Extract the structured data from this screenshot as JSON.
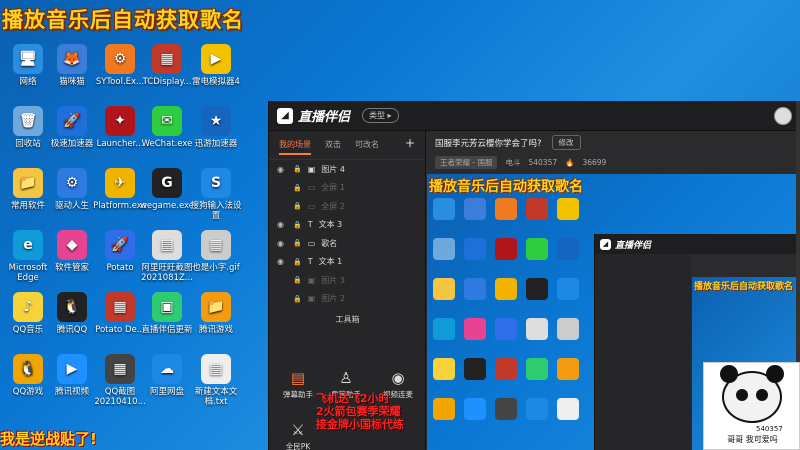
{
  "overlay_title": "播放音乐后自动获取歌名",
  "bottom_banner": "我是逆战贴了!",
  "desktop": {
    "icons": [
      {
        "label": "网络",
        "color": "#2a8ee0",
        "glyph": "🖥"
      },
      {
        "label": "猫咪猫",
        "color": "#3b7dd8",
        "glyph": "🦊"
      },
      {
        "label": "SYTool.Ex...",
        "color": "#f07a20",
        "glyph": "⚙"
      },
      {
        "label": "TCDisplay...",
        "color": "#c0392b",
        "glyph": "▦"
      },
      {
        "label": "雷电模拟器4",
        "color": "#f2c200",
        "glyph": "▶"
      },
      {
        "label": "回收站",
        "color": "#6fa8dc",
        "glyph": "🗑"
      },
      {
        "label": "极速加速器",
        "color": "#1e6fd9",
        "glyph": "🚀"
      },
      {
        "label": "Launcher...",
        "color": "#b0151c",
        "glyph": "✦"
      },
      {
        "label": "WeChat.exe",
        "color": "#2ecc40",
        "glyph": "✉"
      },
      {
        "label": "迅游加速器",
        "color": "#1565c0",
        "glyph": "★"
      },
      {
        "label": "常用软件",
        "color": "#f5c542",
        "glyph": "📁"
      },
      {
        "label": "驱动人生",
        "color": "#2d7be0",
        "glyph": "⚙"
      },
      {
        "label": "Platform.exe",
        "color": "#f0b400",
        "glyph": "✈"
      },
      {
        "label": "wegame.exe",
        "color": "#222222",
        "glyph": "G"
      },
      {
        "label": "搜狗输入法设置",
        "color": "#1e88e5",
        "glyph": "S"
      },
      {
        "label": "Microsoft Edge",
        "color": "#0f9bd7",
        "glyph": "e"
      },
      {
        "label": "软件管家",
        "color": "#e84393",
        "glyph": "◆"
      },
      {
        "label": "Potato",
        "color": "#2f6ee8",
        "glyph": "🚀"
      },
      {
        "label": "阿里旺旺截图 2021081Z...",
        "color": "#dddddd",
        "glyph": "▤"
      },
      {
        "label": "也是小字.gif",
        "color": "#cccccc",
        "glyph": "▦"
      },
      {
        "label": "QQ音乐",
        "color": "#f7d23a",
        "glyph": "♪"
      },
      {
        "label": "腾讯QQ",
        "color": "#222222",
        "glyph": "🐧"
      },
      {
        "label": "Potato De...",
        "color": "#c0392b",
        "glyph": "▦"
      },
      {
        "label": "直播伴侣更新",
        "color": "#2ecc71",
        "glyph": "▣"
      },
      {
        "label": "腾讯游戏",
        "color": "#f39c12",
        "glyph": "📁"
      },
      {
        "label": "QQ游戏",
        "color": "#f0a500",
        "glyph": "🐧"
      },
      {
        "label": "腾讯视频",
        "color": "#1e90ff",
        "glyph": "▶"
      },
      {
        "label": "QQ截图 20210410...",
        "color": "#444444",
        "glyph": "▦"
      },
      {
        "label": "阿里网盘",
        "color": "#1e88e5",
        "glyph": "☁"
      },
      {
        "label": "新建文本文档.txt",
        "color": "#eeeeee",
        "glyph": "▤"
      }
    ]
  },
  "app": {
    "name": "直播伴侣",
    "type_pill": "类型 ▸",
    "tabs": [
      "我的场景",
      "双击",
      "可改名"
    ],
    "layers": [
      {
        "label": "图片 4",
        "dim": false,
        "icon": "▣"
      },
      {
        "label": "全屏 1",
        "dim": true,
        "icon": "▭"
      },
      {
        "label": "全屏 2",
        "dim": true,
        "icon": "▭"
      },
      {
        "label": "文本 3",
        "dim": false,
        "icon": "T"
      },
      {
        "label": "歌名",
        "dim": false,
        "icon": "▭"
      },
      {
        "label": "文本 1",
        "dim": false,
        "icon": "T"
      },
      {
        "label": "图片 3",
        "dim": true,
        "icon": "▣"
      },
      {
        "label": "图片 2",
        "dim": true,
        "icon": "▣"
      }
    ],
    "tools_title": "工具箱",
    "tools": [
      "弹幕助手",
      "房管助手",
      "视频连麦",
      "全民PK"
    ],
    "room_title": "国服李元芳云樱你学会了吗?",
    "edit_label": "修改",
    "game_tag": "王者荣耀 - 国服",
    "stat_label_1": "电斗",
    "stat_value_1": "540357",
    "stat_value_2": "36699"
  },
  "preview": {
    "title": "播放音乐后自动获取歌名",
    "nested_app_name": "直播伴侣",
    "nested_title": "播放音乐后自动获取歌名"
  },
  "overlay_red": {
    "line1": "飞机达飞2小时",
    "line2": "2火箭包赛季荣耀",
    "line3": "接金牌小国标代练"
  },
  "panda": {
    "number": "540357",
    "caption": "哥哥 我可爱吗"
  }
}
